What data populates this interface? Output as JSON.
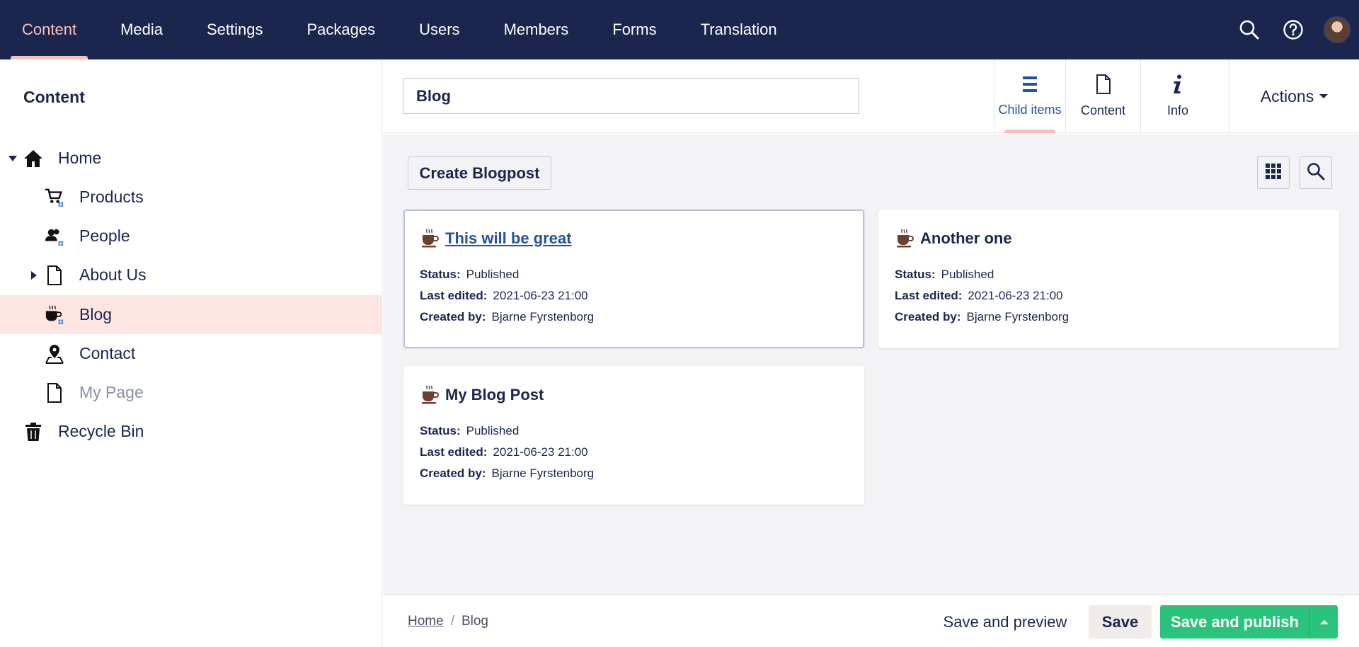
{
  "topnav": {
    "items": [
      {
        "label": "Content",
        "active": true
      },
      {
        "label": "Media"
      },
      {
        "label": "Settings"
      },
      {
        "label": "Packages"
      },
      {
        "label": "Users"
      },
      {
        "label": "Members"
      },
      {
        "label": "Forms"
      },
      {
        "label": "Translation"
      }
    ],
    "icons": [
      "search-icon",
      "help-icon",
      "avatar"
    ]
  },
  "sidebar": {
    "title": "Content",
    "tree": [
      {
        "label": "Home",
        "icon": "home-icon",
        "expanded": true
      },
      {
        "label": "Products",
        "icon": "shopping-cart-icon"
      },
      {
        "label": "People",
        "icon": "users-icon"
      },
      {
        "label": "About Us",
        "icon": "document-icon",
        "collapsed": true
      },
      {
        "label": "Blog",
        "icon": "coffee-cup-icon",
        "selected": true
      },
      {
        "label": "Contact",
        "icon": "map-pin-icon"
      },
      {
        "label": "My Page",
        "icon": "document-icon",
        "muted": true
      },
      {
        "label": "Recycle Bin",
        "icon": "trash-icon"
      }
    ]
  },
  "editor": {
    "name_value": "Blog",
    "apps": [
      {
        "label": "Child items",
        "icon": "list-icon",
        "active": true
      },
      {
        "label": "Content",
        "icon": "document-icon"
      },
      {
        "label": "Info",
        "icon": "info-icon"
      }
    ],
    "actions_label": "Actions"
  },
  "listview": {
    "create_label": "Create Blogpost",
    "view_buttons": [
      "grid-view-icon",
      "search-icon"
    ],
    "status_label": "Status:",
    "edited_label": "Last edited:",
    "created_label": "Created by:",
    "items": [
      {
        "title": "This will be great",
        "status": "Published",
        "last_edited": "2021-06-23 21:00",
        "created_by": "Bjarne Fyrstenborg",
        "hovered": true
      },
      {
        "title": "Another one",
        "status": "Published",
        "last_edited": "2021-06-23 21:00",
        "created_by": "Bjarne Fyrstenborg"
      },
      {
        "title": "My Blog Post",
        "status": "Published",
        "last_edited": "2021-06-23 21:00",
        "created_by": "Bjarne Fyrstenborg"
      }
    ]
  },
  "footer": {
    "breadcrumb": [
      {
        "label": "Home"
      },
      {
        "label": "Blog"
      }
    ],
    "save_preview_label": "Save and preview",
    "save_label": "Save",
    "save_publish_label": "Save and publish"
  },
  "colors": {
    "nav_bg": "#1b264f",
    "nav_active": "#f5c1bc",
    "selected_row": "#fde6e2",
    "publish_green": "#2bc37c",
    "link_blue": "#2152a3"
  }
}
